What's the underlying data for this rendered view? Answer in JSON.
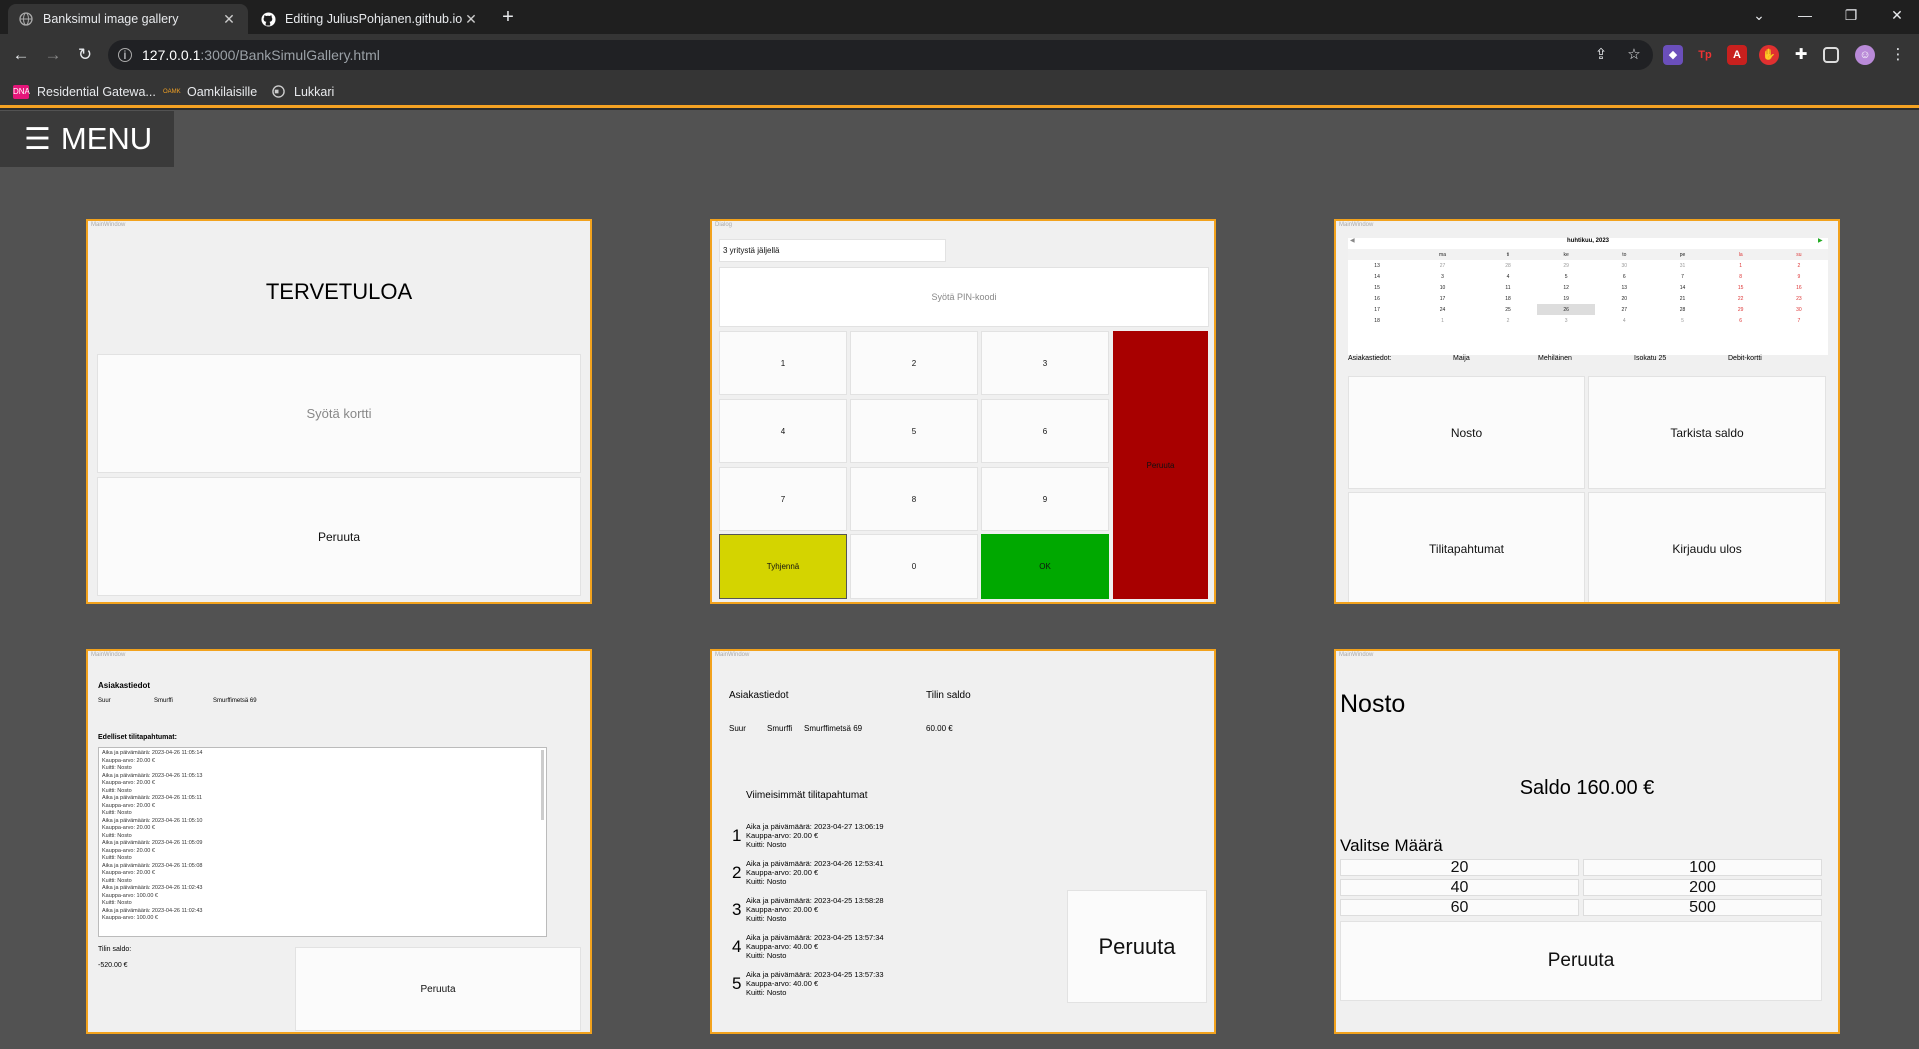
{
  "browser": {
    "tabs": [
      {
        "title": "Banksimul image gallery",
        "active": true
      },
      {
        "title": "Editing JuliusPohjanen.github.io/",
        "active": false
      }
    ],
    "url_host": "127.0.0.1",
    "url_path": ":3000/BankSimulGallery.html",
    "bookmarks": [
      {
        "label": "Residential Gatewa...",
        "icon": "dna-icon",
        "badge": "DNA"
      },
      {
        "label": "Oamkilaisille",
        "icon": "oamk-icon",
        "badge": "OAMK"
      },
      {
        "label": "Lukkari",
        "icon": "globe-icon",
        "badge": ""
      }
    ],
    "colors": {
      "accent": "#f4a223",
      "tabbar": "#1f1f1f",
      "toolbar": "#353535",
      "page_bg": "#525252"
    }
  },
  "menu": {
    "label": "MENU",
    "icon": "hamburger-icon"
  },
  "gallery": {
    "welcome": {
      "window_title": "MainWindow",
      "heading": "TERVETULOA",
      "insert_card": "Syötä kortti",
      "cancel": "Peruuta"
    },
    "pin": {
      "window_title": "Dialog",
      "attempts": "3 yritystä jäljellä",
      "prompt": "Syötä PIN-koodi",
      "keys": [
        "1",
        "2",
        "3",
        "4",
        "5",
        "6",
        "7",
        "8",
        "9"
      ],
      "zero": "0",
      "clear": "Tyhjennä",
      "ok": "OK",
      "cancel": "Peruuta",
      "colors": {
        "clear": "#d4d400",
        "ok": "#00a800",
        "cancel": "#a80000"
      }
    },
    "menu_window": {
      "window_title": "MainWindow",
      "calendar_title": "huhtikuu, 2023",
      "weekdays": [
        "ma",
        "ti",
        "ke",
        "to",
        "pe",
        "la",
        "su"
      ],
      "weeks": [
        {
          "w": "13",
          "d": [
            "27",
            "28",
            "29",
            "30",
            "31",
            "1",
            "2"
          ]
        },
        {
          "w": "14",
          "d": [
            "3",
            "4",
            "5",
            "6",
            "7",
            "8",
            "9"
          ]
        },
        {
          "w": "15",
          "d": [
            "10",
            "11",
            "12",
            "13",
            "14",
            "15",
            "16"
          ]
        },
        {
          "w": "16",
          "d": [
            "17",
            "18",
            "19",
            "20",
            "21",
            "22",
            "23"
          ]
        },
        {
          "w": "17",
          "d": [
            "24",
            "25",
            "26",
            "27",
            "28",
            "29",
            "30"
          ]
        },
        {
          "w": "18",
          "d": [
            "1",
            "2",
            "3",
            "4",
            "5",
            "6",
            "7"
          ]
        }
      ],
      "customer_label": "Asiakastiedot:",
      "first_name": "Maija",
      "last_name": "Mehiläinen",
      "address": "Isokatu 25",
      "card_type": "Debit-kortti",
      "buttons": [
        "Nosto",
        "Tarkista saldo",
        "Tilitapahtumat",
        "Kirjaudu ulos"
      ]
    },
    "history": {
      "window_title": "MainWindow",
      "customer_heading": "Asiakastiedot",
      "first_name": "Suur",
      "last_name": "Smurffi",
      "address": "Smurffimetsä 69",
      "list_heading": "Edelliset tilitapahtumat:",
      "entries": [
        {
          "time": "Aika ja päivämäärä: 2023-04-26 11:05:14",
          "amount": "Kauppa-arvo: 20.00 €",
          "receipt": "Kuitti: Nosto"
        },
        {
          "time": "Aika ja päivämäärä: 2023-04-26 11:05:13",
          "amount": "Kauppa-arvo: 20.00 €",
          "receipt": "Kuitti: Nosto"
        },
        {
          "time": "Aika ja päivämäärä: 2023-04-26 11:05:11",
          "amount": "Kauppa-arvo: 20.00 €",
          "receipt": "Kuitti: Nosto"
        },
        {
          "time": "Aika ja päivämäärä: 2023-04-26 11:05:10",
          "amount": "Kauppa-arvo: 20.00 €",
          "receipt": "Kuitti: Nosto"
        },
        {
          "time": "Aika ja päivämäärä: 2023-04-26 11:05:09",
          "amount": "Kauppa-arvo: 20.00 €",
          "receipt": "Kuitti: Nosto"
        },
        {
          "time": "Aika ja päivämäärä: 2023-04-26 11:05:08",
          "amount": "Kauppa-arvo: 20.00 €",
          "receipt": "Kuitti: Nosto"
        },
        {
          "time": "Aika ja päivämäärä: 2023-04-26 11:02:43",
          "amount": "Kauppa-arvo: 100.00 €",
          "receipt": "Kuitti: Nosto"
        },
        {
          "time": "Aika ja päivämäärä: 2023-04-26 11:02:43",
          "amount": "Kauppa-arvo: 100.00 €",
          "receipt": ""
        }
      ],
      "balance_label": "Tilin saldo:",
      "balance": "-520.00 €",
      "cancel": "Peruuta"
    },
    "balance": {
      "window_title": "MainWindow",
      "customer_heading": "Asiakastiedot",
      "balance_heading": "Tilin saldo",
      "first_name": "Suur",
      "last_name": "Smurffi",
      "address": "Smurffimetsä 69",
      "balance": "60.00 €",
      "recent_heading": "Viimeisimmät tilitapahtumat",
      "transactions": [
        {
          "n": "1",
          "time": "Aika ja päivämäärä: 2023-04-27 13:06:19",
          "amount": "Kauppa-arvo: 20.00 €",
          "receipt": "Kuitti: Nosto"
        },
        {
          "n": "2",
          "time": "Aika ja päivämäärä: 2023-04-26 12:53:41",
          "amount": "Kauppa-arvo: 20.00 €",
          "receipt": "Kuitti: Nosto"
        },
        {
          "n": "3",
          "time": "Aika ja päivämäärä: 2023-04-25 13:58:28",
          "amount": "Kauppa-arvo: 20.00 €",
          "receipt": "Kuitti: Nosto"
        },
        {
          "n": "4",
          "time": "Aika ja päivämäärä: 2023-04-25 13:57:34",
          "amount": "Kauppa-arvo: 40.00 €",
          "receipt": "Kuitti: Nosto"
        },
        {
          "n": "5",
          "time": "Aika ja päivämäärä: 2023-04-25 13:57:33",
          "amount": "Kauppa-arvo: 40.00 €",
          "receipt": "Kuitti: Nosto"
        }
      ],
      "cancel": "Peruuta"
    },
    "withdraw": {
      "window_title": "MainWindow",
      "heading": "Nosto",
      "balance_text": "Saldo 160.00 €",
      "choose_label": "Valitse Määrä",
      "amounts": [
        "20",
        "100",
        "40",
        "200",
        "60",
        "500"
      ],
      "cancel": "Peruuta"
    }
  }
}
